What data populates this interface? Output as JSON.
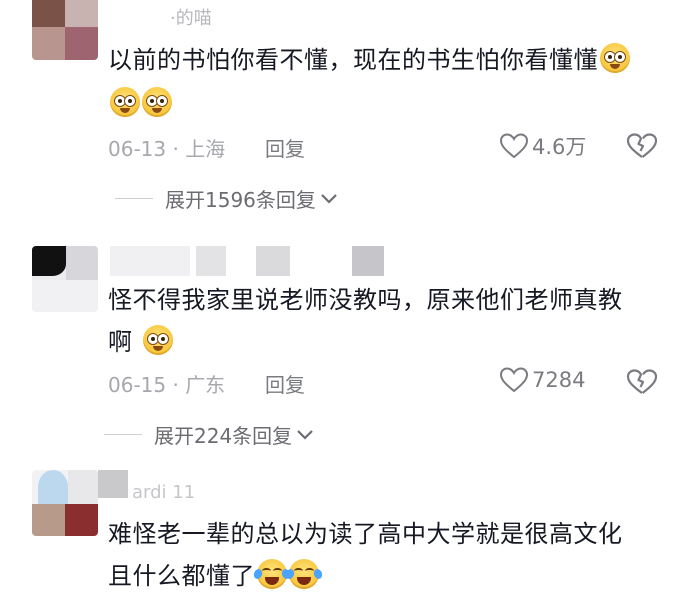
{
  "comments": [
    {
      "username": "·的喵",
      "text_line1": "以前的书怕你看不懂，现在的书生怕你看懂懂",
      "text_line2": "",
      "date_location": "06-13 · 上海",
      "reply_label": "回复",
      "likes": "4.6万",
      "expand_label": "展开1596条回复",
      "emojis_line1": [
        "amazed-emoji"
      ],
      "emojis_line2": [
        "amazed-emoji",
        "amazed-emoji"
      ]
    },
    {
      "username": "",
      "text_line1": "怪不得我家里说老师没教吗，原来他们老师真教",
      "text_line2": "啊",
      "date_location": "06-15 · 广东",
      "reply_label": "回复",
      "likes": "7284",
      "expand_label": "展开224条回复",
      "emojis_line2": [
        "amazed-emoji"
      ]
    },
    {
      "username": "ardi  11",
      "text_line1": "难怪老一辈的总以为读了高中大学就是很高文化",
      "text_line2": "且什么都懂了",
      "emojis_line2": [
        "laughing-tears-emoji",
        "laughing-tears-emoji"
      ]
    }
  ],
  "colors": {
    "text": "#161823",
    "meta": "#a7a8ad",
    "action": "#7a7b80"
  }
}
